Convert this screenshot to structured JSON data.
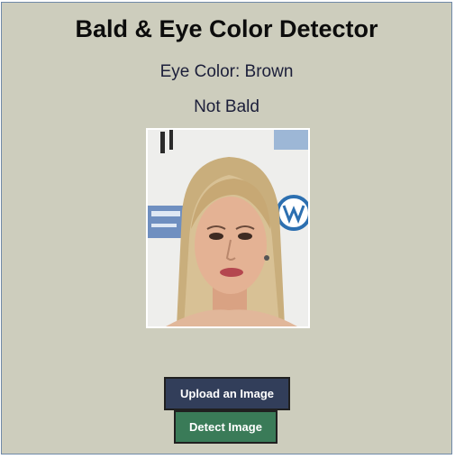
{
  "app": {
    "title": "Bald & Eye Color Detector"
  },
  "results": {
    "eye_color_text": "Eye Color: Brown",
    "bald_text": "Not Bald"
  },
  "buttons": {
    "upload_label": "Upload an Image",
    "detect_label": "Detect Image"
  },
  "colors": {
    "background": "#cdcdbd",
    "upload_button": "#323e5a",
    "detect_button": "#3a7b58"
  }
}
